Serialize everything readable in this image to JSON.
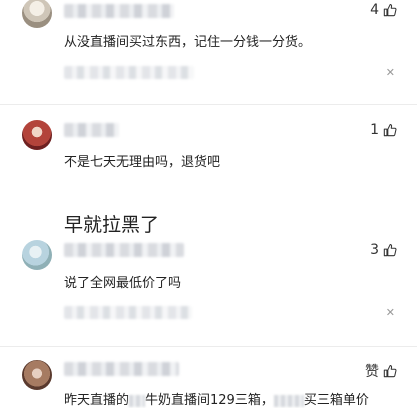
{
  "comments": [
    {
      "likes": "4",
      "text": "从没直播间买过东西，记住一分钱一分货。",
      "large": false
    },
    {
      "likes": "1",
      "text": "不是七天无理由吗，退货吧",
      "reply": "早就拉黑了"
    },
    {
      "likes": "3",
      "text": "说了全网最低价了吗"
    },
    {
      "likes": "赞",
      "text_parts": [
        "昨天直播的",
        "牛奶直播间129三箱，",
        "买三箱单价"
      ]
    }
  ],
  "colors": {
    "text": "#222222",
    "muted": "#999999",
    "divider": "#ececec"
  },
  "icons": {
    "like": "thumb-up-icon",
    "dismiss": "close-icon"
  }
}
